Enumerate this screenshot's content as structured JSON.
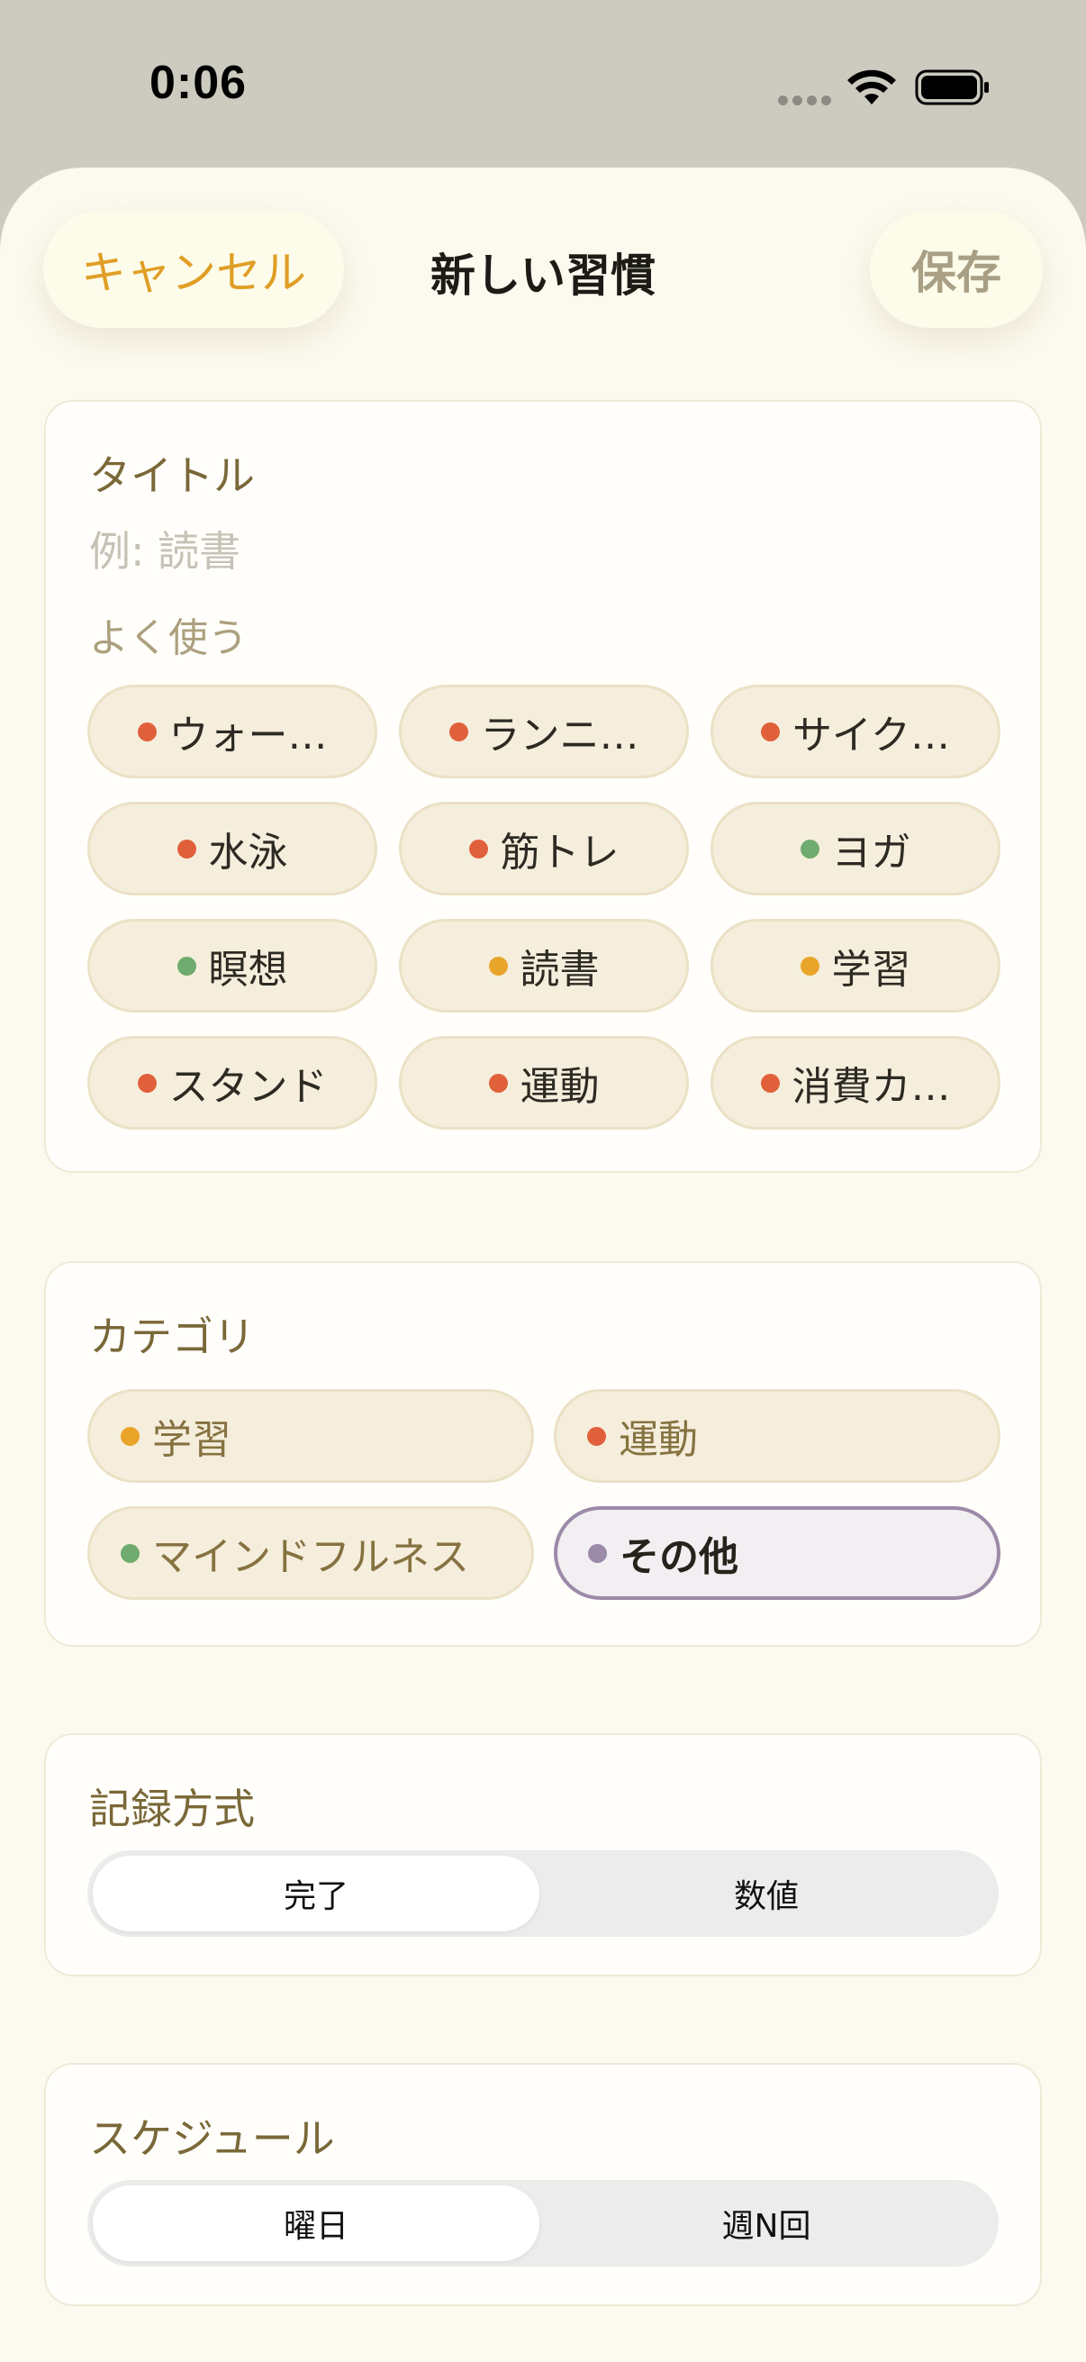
{
  "status_bar": {
    "time": "0:06"
  },
  "nav": {
    "cancel": "キャンセル",
    "title": "新しい習慣",
    "save": "保存"
  },
  "title_section": {
    "label": "タイトル",
    "placeholder": "例: 読書",
    "frequent_label": "よく使う",
    "chips": [
      {
        "label": "ウォー…",
        "color": "#e1603c"
      },
      {
        "label": "ランニ…",
        "color": "#e1603c"
      },
      {
        "label": "サイク…",
        "color": "#e1603c"
      },
      {
        "label": "水泳",
        "color": "#e1603c"
      },
      {
        "label": "筋トレ",
        "color": "#e1603c"
      },
      {
        "label": "ヨガ",
        "color": "#6fab6e"
      },
      {
        "label": "瞑想",
        "color": "#6fab6e"
      },
      {
        "label": "読書",
        "color": "#e9a42a"
      },
      {
        "label": "学習",
        "color": "#e9a42a"
      },
      {
        "label": "スタンド",
        "color": "#e1603c"
      },
      {
        "label": "運動",
        "color": "#e1603c"
      },
      {
        "label": "消費カ…",
        "color": "#e1603c"
      }
    ]
  },
  "category_section": {
    "label": "カテゴリ",
    "options": [
      {
        "label": "学習",
        "color": "#e9a42a"
      },
      {
        "label": "運動",
        "color": "#e1603c"
      },
      {
        "label": "マインドフルネス",
        "color": "#6fab6e"
      },
      {
        "label": "その他",
        "color": "#9b8aa8",
        "selected": true
      }
    ]
  },
  "record_section": {
    "label": "記録方式",
    "options": [
      "完了",
      "数値"
    ],
    "selected": "完了"
  },
  "schedule_section": {
    "label": "スケジュール",
    "options": [
      "曜日",
      "週N回"
    ],
    "selected": "曜日"
  }
}
